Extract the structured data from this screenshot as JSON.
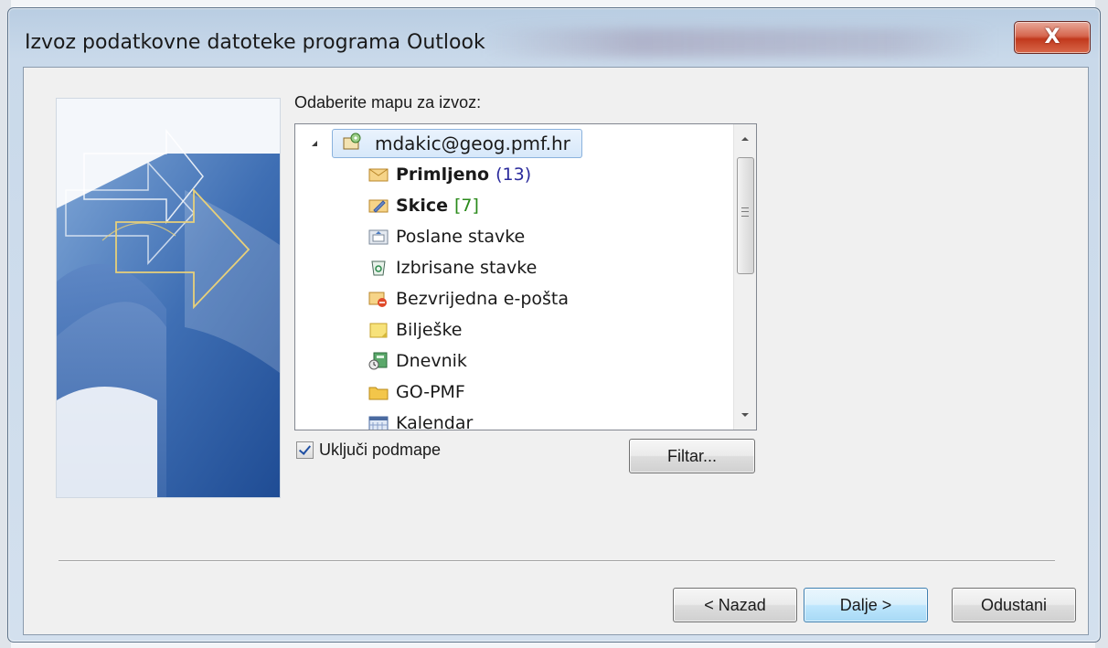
{
  "window": {
    "title": "Izvoz podatkovne datoteke programa Outlook",
    "close_symbol": "X"
  },
  "prompt_label": "Odaberite mapu za izvoz:",
  "tree": {
    "root": {
      "label": "mdakic@geog.pmf.hr",
      "icon": "mailbox-icon",
      "expanded": true,
      "selected": true
    },
    "items": [
      {
        "label": "Primljeno",
        "count": "(13)",
        "bold": true,
        "count_color": "#2a2a9c",
        "icon": "inbox-icon"
      },
      {
        "label": "Skice",
        "count": "[7]",
        "bold": true,
        "count_color": "#2a8a1a",
        "icon": "drafts-icon"
      },
      {
        "label": "Poslane stavke",
        "count": "",
        "bold": false,
        "icon": "sent-items-icon"
      },
      {
        "label": "Izbrisane stavke",
        "count": "",
        "bold": false,
        "icon": "deleted-items-icon"
      },
      {
        "label": "Bezvrijedna e-pošta",
        "count": "",
        "bold": false,
        "icon": "junk-mail-icon"
      },
      {
        "label": "Bilješke",
        "count": "",
        "bold": false,
        "icon": "notes-icon"
      },
      {
        "label": "Dnevnik",
        "count": "",
        "bold": false,
        "icon": "journal-icon"
      },
      {
        "label": "GO-PMF",
        "count": "",
        "bold": false,
        "icon": "folder-icon"
      },
      {
        "label": "Kalendar",
        "count": "",
        "bold": false,
        "icon": "calendar-icon"
      }
    ]
  },
  "include_subfolders": {
    "label": "Uključi podmape",
    "checked": true
  },
  "buttons": {
    "filter": "Filtar...",
    "back": "< Nazad",
    "next": "Dalje >",
    "cancel": "Odustani"
  },
  "colors": {
    "accent_blue": "#3c7fb1",
    "close_red": "#c1391d",
    "selection": "#d7e8fa"
  }
}
